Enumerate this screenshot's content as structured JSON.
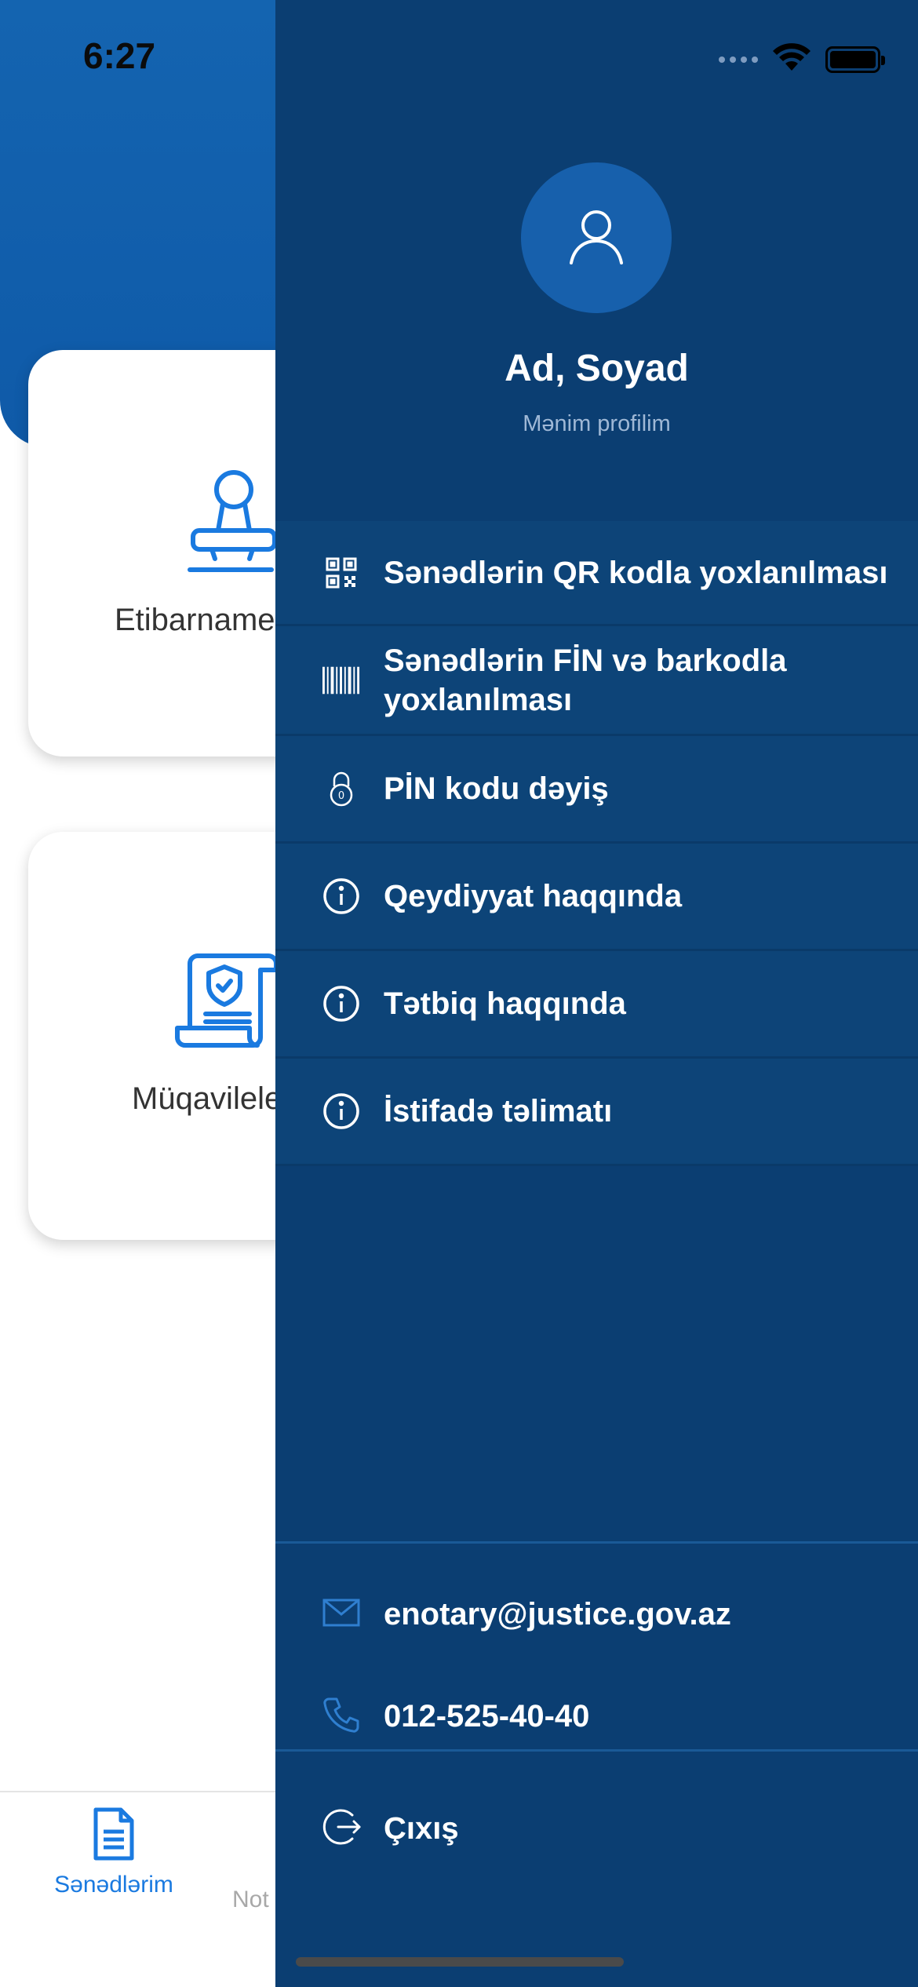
{
  "status_bar": {
    "time": "6:27"
  },
  "background": {
    "cards": [
      {
        "label": "Etibarname",
        "icon": "stamp-icon"
      },
      {
        "label": "Müqavilele",
        "icon": "contract-shield-icon"
      }
    ],
    "tabs": [
      {
        "label": "Sənədlərim",
        "icon": "document-icon",
        "active": true
      },
      {
        "label": "Not",
        "icon": "notary-icon",
        "active": false
      }
    ],
    "colors": {
      "header": "#1464b0",
      "active_tab": "#1a7ae0"
    }
  },
  "drawer": {
    "profile": {
      "name": "Ad, Soyad",
      "subtitle": "Mənim profilim",
      "icon": "user-icon"
    },
    "menu": [
      {
        "label": "Sənədlərin QR kodla yoxlanılması",
        "icon": "qr-code-icon"
      },
      {
        "label": "Sənədlərin FİN və barkodla yoxlanılması",
        "icon": "barcode-icon"
      },
      {
        "label": "PİN kodu dəyiş",
        "icon": "lock-icon"
      },
      {
        "label": "Qeydiyyat haqqında",
        "icon": "info-icon"
      },
      {
        "label": "Tətbiq haqqında",
        "icon": "info-icon"
      },
      {
        "label": "İstifadə təlimatı",
        "icon": "info-icon"
      }
    ],
    "contacts": {
      "email": "enotary@justice.gov.az",
      "phone": "012-525-40-40"
    },
    "logout_label": "Çıxış",
    "colors": {
      "drawer_bg": "#0b3e72",
      "menu_item_bg": "#0d4478",
      "icon_blue": "#2f7fd0"
    }
  }
}
